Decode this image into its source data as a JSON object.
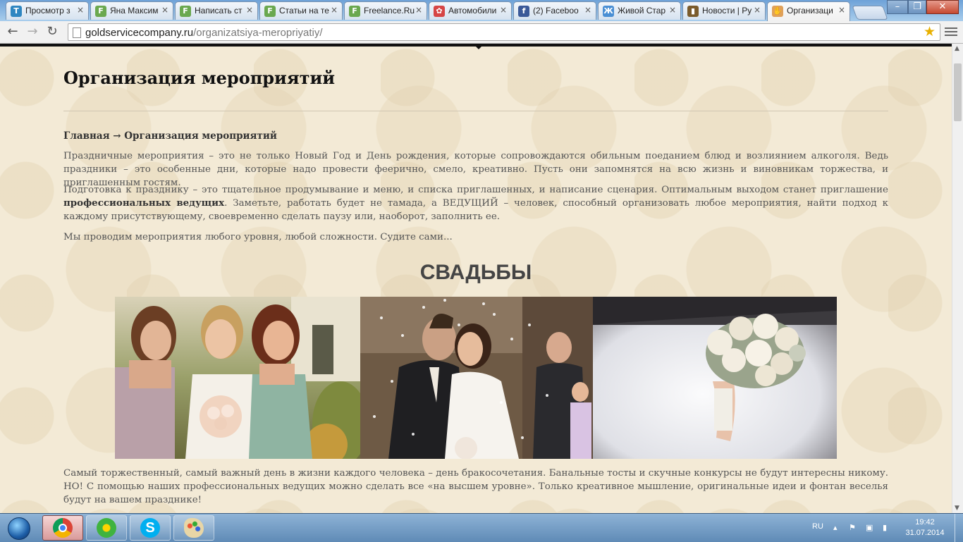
{
  "browser": {
    "tabs": [
      {
        "title": "Просмотр з",
        "favicon": "Т",
        "favicon_color": "#2e86c1"
      },
      {
        "title": "Яна Максим",
        "favicon": "F",
        "favicon_color": "#6aa84f"
      },
      {
        "title": "Написать ст",
        "favicon": "F",
        "favicon_color": "#6aa84f"
      },
      {
        "title": "Статьи на те",
        "favicon": "F",
        "favicon_color": "#6aa84f"
      },
      {
        "title": "Freelance.Ru",
        "favicon": "F",
        "favicon_color": "#6aa84f"
      },
      {
        "title": "Автомобили",
        "favicon": "✿",
        "favicon_color": "#d64545"
      },
      {
        "title": "(2) Faceboo",
        "favicon": "f",
        "favicon_color": "#3b5998"
      },
      {
        "title": "Живой Стар",
        "favicon": "Ж",
        "favicon_color": "#4a8fd4"
      },
      {
        "title": "Новости | Ру",
        "favicon": "▮",
        "favicon_color": "#7a5b2c"
      },
      {
        "title": "Организаци",
        "favicon": "✋",
        "favicon_color": "#e0a15a",
        "active": true
      }
    ],
    "url_domain": "goldservicecompany.ru",
    "url_path": "/organizatsiya-meropriyatiy/"
  },
  "page": {
    "title": "Организация мероприятий",
    "breadcrumb_home": "Главная",
    "breadcrumb_sep": " → ",
    "breadcrumb_current": "Организация мероприятий",
    "para1": "Праздничные мероприятия – это не только Новый Год и День рождения, которые сопровождаются обильным поеданием блюд и возлиянием алкоголя. Ведь праздники – это особенные дни, которые надо провести феерично, смело, креативно. Пусть они запомнятся на всю жизнь и виновникам торжества, и приглашенным гостям.",
    "para2_start": "Подготовка к празднику – это тщательное продумывание и меню, и списка приглашенных, и написание сценария. Оптимальным выходом станет приглашение ",
    "para2_bold": "профессиональных ведущих",
    "para2_end": ". Заметьте, работать будет не тамада, а ВЕДУЩИЙ – человек, способный организовать любое мероприятия, найти подход к каждому присутствующему, своевременно сделать паузу или, наоборот, заполнить ее.",
    "para3": "Мы проводим мероприятия любого уровня, любой сложности. Судите сами...",
    "weddings_heading": "СВАДЬБЫ",
    "para4": "Самый торжественный, самый важный день в жизни каждого человека – день бракосочетания. Банальные тосты и скучные конкурсы не будут интересны никому. НО! С помощью наших профессиональных ведущих можно сделать все «на высшем уровне».  Только креативное мышление, оригинальные идеи и фонтан веселья будут на вашем празднике!"
  },
  "taskbar": {
    "lang": "RU",
    "time": "19:42",
    "date": "31.07.2014"
  }
}
